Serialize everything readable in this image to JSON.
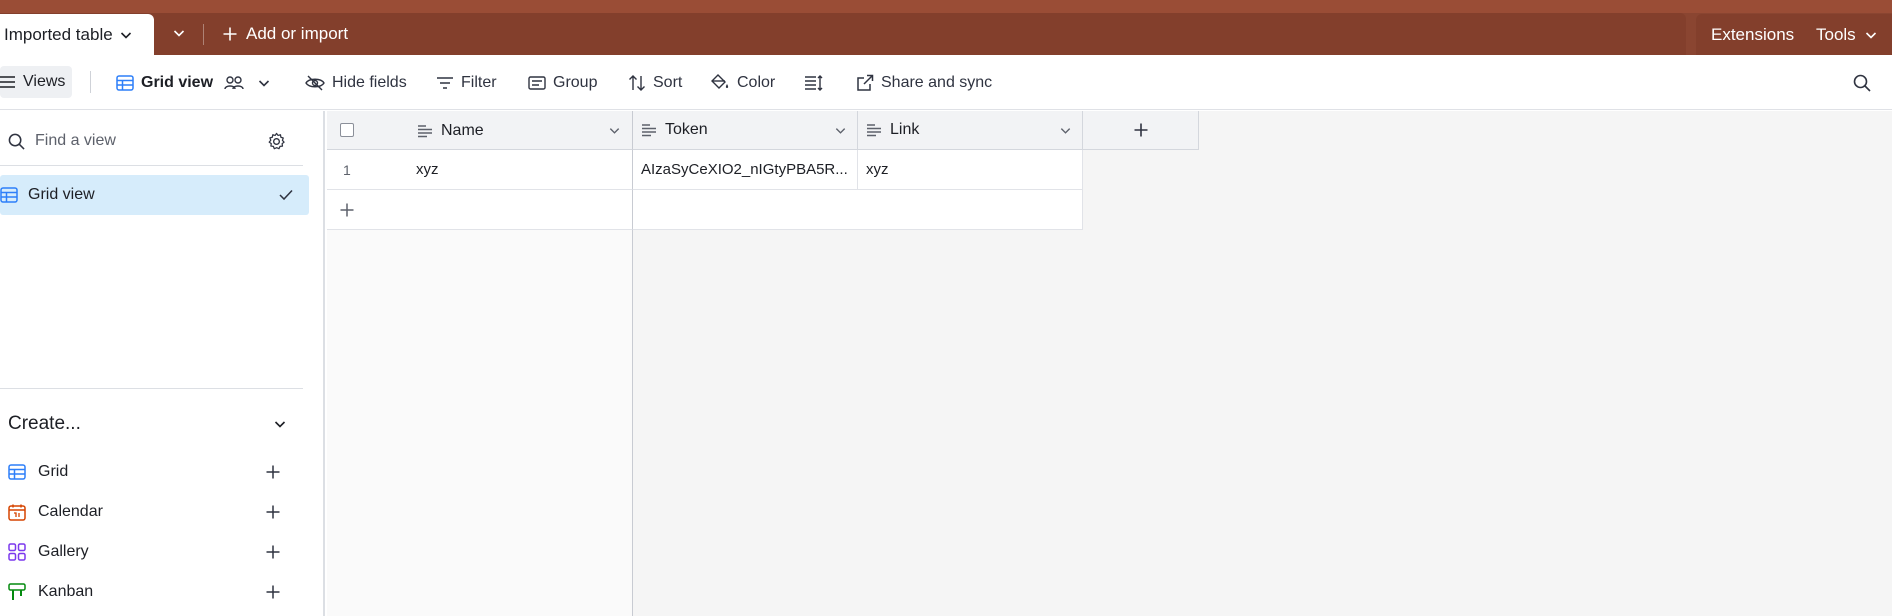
{
  "topbar": {
    "active_tab": "Imported table",
    "add_or_import": "Add or import",
    "extensions": "Extensions",
    "tools": "Tools"
  },
  "toolbar": {
    "views": "Views",
    "grid_view": "Grid view",
    "hide_fields": "Hide fields",
    "filter": "Filter",
    "group": "Group",
    "sort": "Sort",
    "color": "Color",
    "share_and_sync": "Share and sync"
  },
  "sidebar": {
    "find_placeholder": "Find a view",
    "views": [
      {
        "label": "Grid view",
        "icon": "grid-icon",
        "selected": true
      }
    ],
    "create_label": "Create...",
    "create_items": [
      {
        "label": "Grid",
        "icon": "grid-icon",
        "color": "#2d7ff9"
      },
      {
        "label": "Calendar",
        "icon": "calendar-icon",
        "color": "#d54401"
      },
      {
        "label": "Gallery",
        "icon": "gallery-icon",
        "color": "#7c39ed"
      },
      {
        "label": "Kanban",
        "icon": "kanban-icon",
        "color": "#048a0e"
      }
    ]
  },
  "grid": {
    "columns": [
      "Name",
      "Token",
      "Link"
    ],
    "rows": [
      {
        "number": "1",
        "name": "xyz",
        "token": "AIzaSyCeXIO2_nIGtyPBA5R...",
        "link": "xyz"
      }
    ]
  },
  "colors": {
    "topbar": "#8a4531",
    "accent": "#2d7ff9",
    "selected_view_bg": "#d6ecfb"
  }
}
